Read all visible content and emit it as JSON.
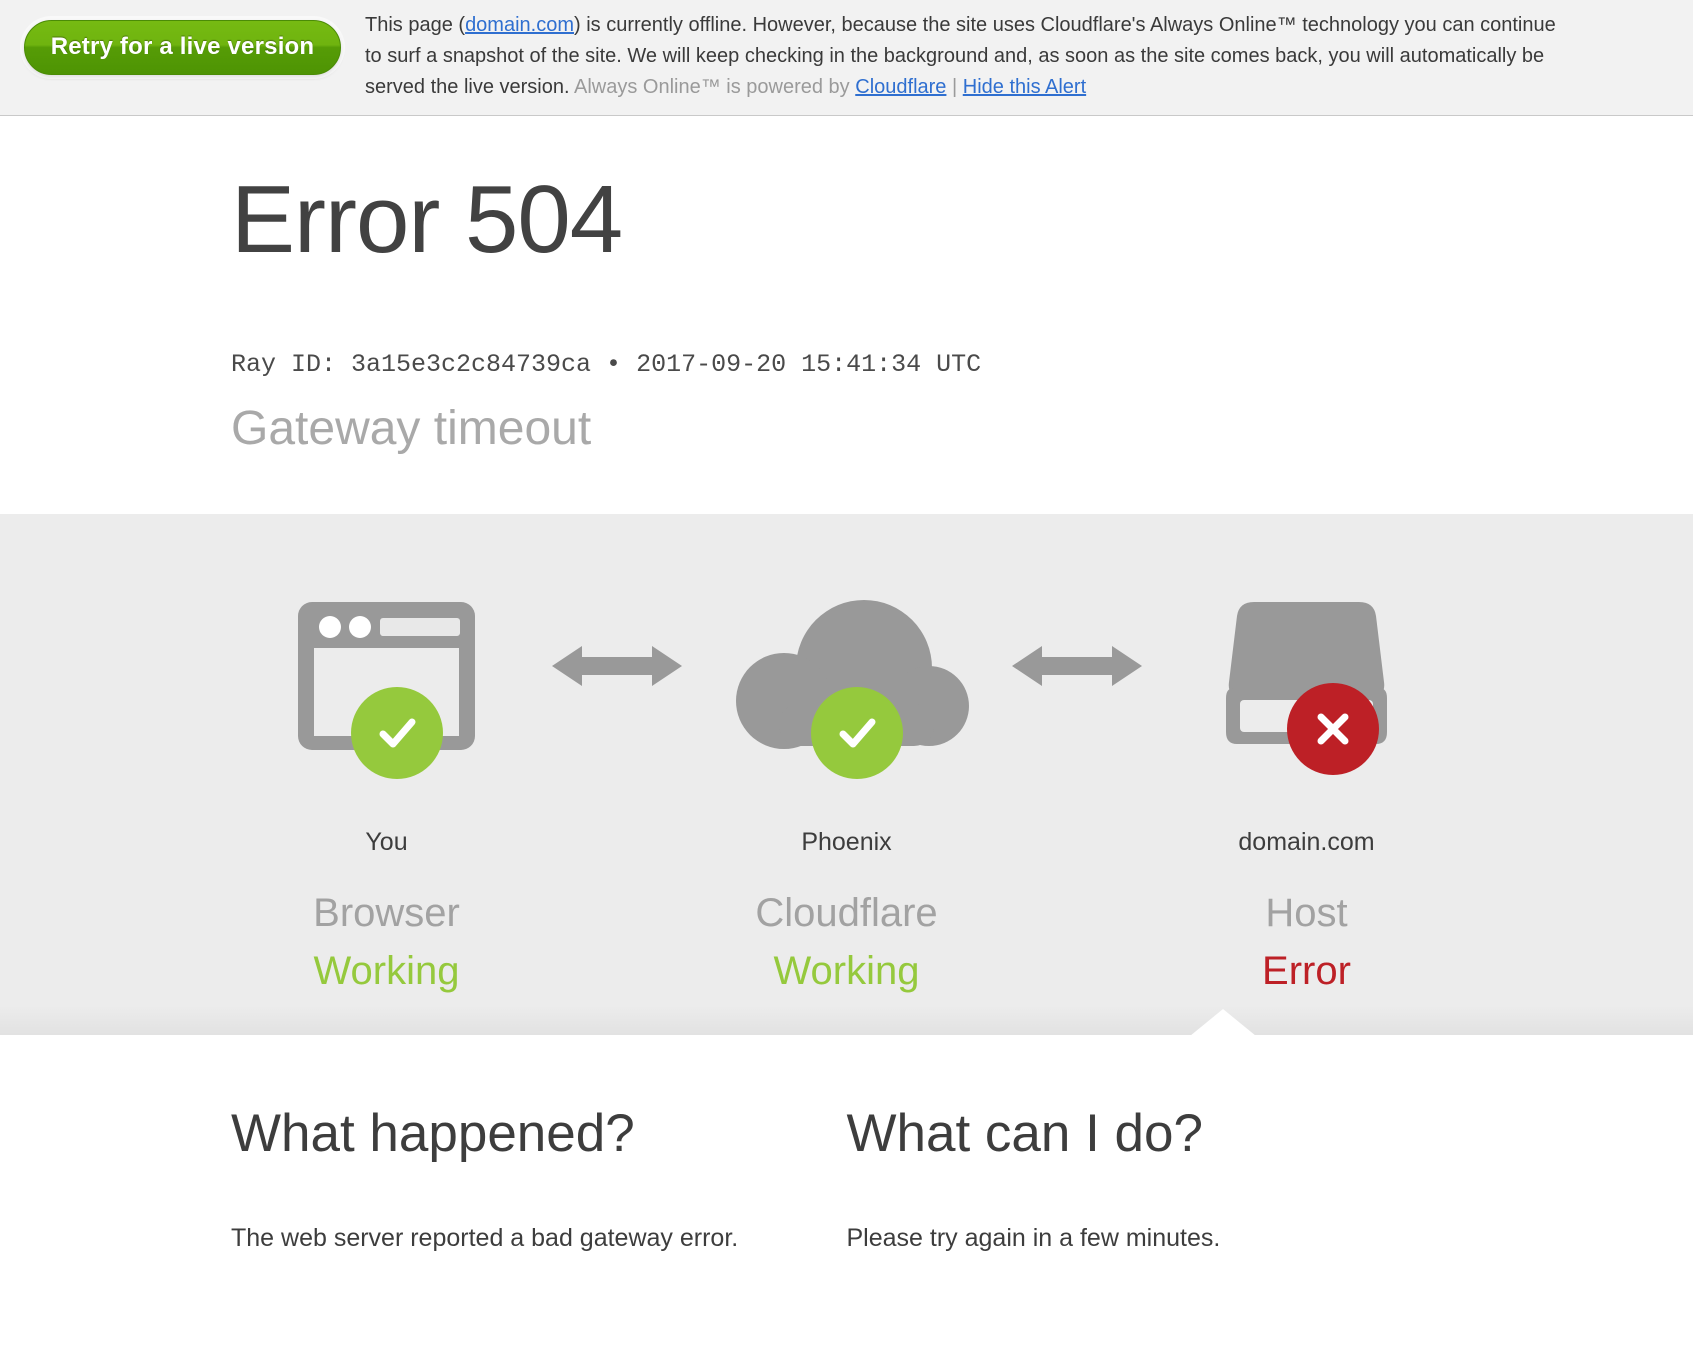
{
  "alert": {
    "retry_label": "Retry for a live version",
    "text_part1": "This page (",
    "domain_link": "domain.com",
    "text_part2": ") is currently offline. However, because the site uses Cloudflare's Always Online™ technology you can continue to surf a snapshot of the site. We will keep checking in the background and, as soon as the site comes back, you will automatically be served the live version.",
    "powered_prefix": "Always Online™ is powered by",
    "cloudflare_link": "Cloudflare",
    "separator": "|",
    "hide_link": "Hide this Alert"
  },
  "header": {
    "error_title": "Error 504",
    "ray_id": "Ray ID: 3a15e3c2c84739ca • 2017-09-20 15:41:34 UTC",
    "subtitle": "Gateway timeout"
  },
  "diagram": {
    "nodes": [
      {
        "icon": "browser-icon",
        "node_label": "You",
        "kind_label": "Browser",
        "status_label": "Working",
        "status_type": "ok",
        "badge": "check-badge"
      },
      {
        "icon": "cloud-icon",
        "node_label": "Phoenix",
        "kind_label": "Cloudflare",
        "status_label": "Working",
        "status_type": "ok",
        "badge": "check-badge"
      },
      {
        "icon": "server-icon",
        "node_label": "domain.com",
        "kind_label": "Host",
        "status_label": "Error",
        "status_type": "err",
        "badge": "x-badge"
      }
    ],
    "connector": "double-arrow-icon"
  },
  "bottom": {
    "sections": [
      {
        "heading": "What happened?",
        "body": "The web server reported a bad gateway error."
      },
      {
        "heading": "What can I do?",
        "body": "Please try again in a few minutes."
      }
    ]
  },
  "colors": {
    "ok_green": "#95c93d",
    "error_red": "#bd2026",
    "icon_gray": "#999999",
    "panel_gray": "#ececec",
    "link_blue": "#2f6fd0"
  }
}
